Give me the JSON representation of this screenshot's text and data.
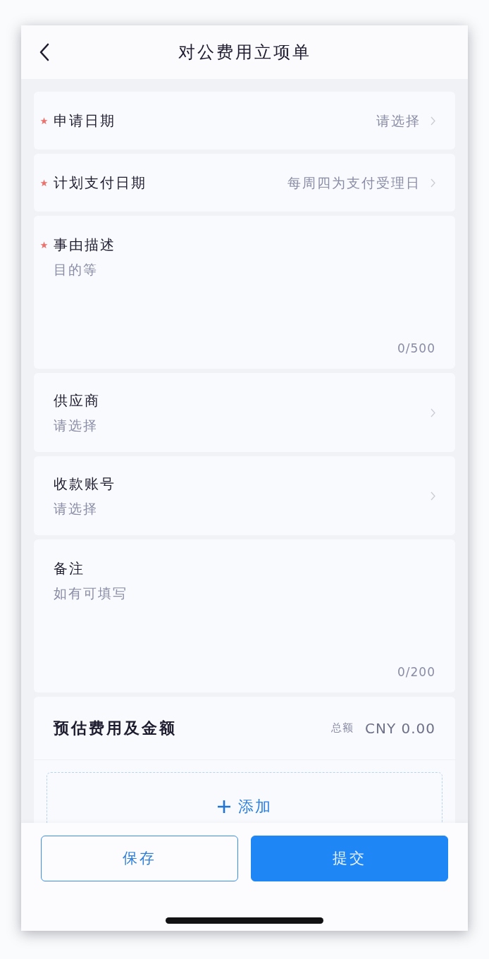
{
  "nav_bar": {
    "title": "对公费用立项单"
  },
  "fields": [
    {
      "kind": "select",
      "label": "申请日期",
      "required": true,
      "placeholder": "请选择"
    },
    {
      "kind": "select",
      "label": "计划支付日期",
      "required": true,
      "placeholder": "每周四为支付受理日"
    },
    {
      "kind": "textarea",
      "label": "事由描述",
      "required": true,
      "placeholder": "目的等",
      "counter": "0/500"
    },
    {
      "kind": "picker",
      "label": "供应商",
      "required": false,
      "placeholder": "请选择"
    },
    {
      "kind": "picker",
      "label": "收款账号",
      "required": false,
      "placeholder": "请选择"
    },
    {
      "kind": "textarea",
      "label": "备注",
      "required": false,
      "placeholder": "如有可填写",
      "counter": "0/200"
    }
  ],
  "expenses": {
    "title": "预估费用及金额",
    "total_label": "总额",
    "total": "CNY 0.00",
    "add_button": "添加"
  },
  "actions": [
    {
      "kind": "secondary",
      "label": "保存"
    },
    {
      "kind": "primary",
      "label": "提交"
    }
  ]
}
